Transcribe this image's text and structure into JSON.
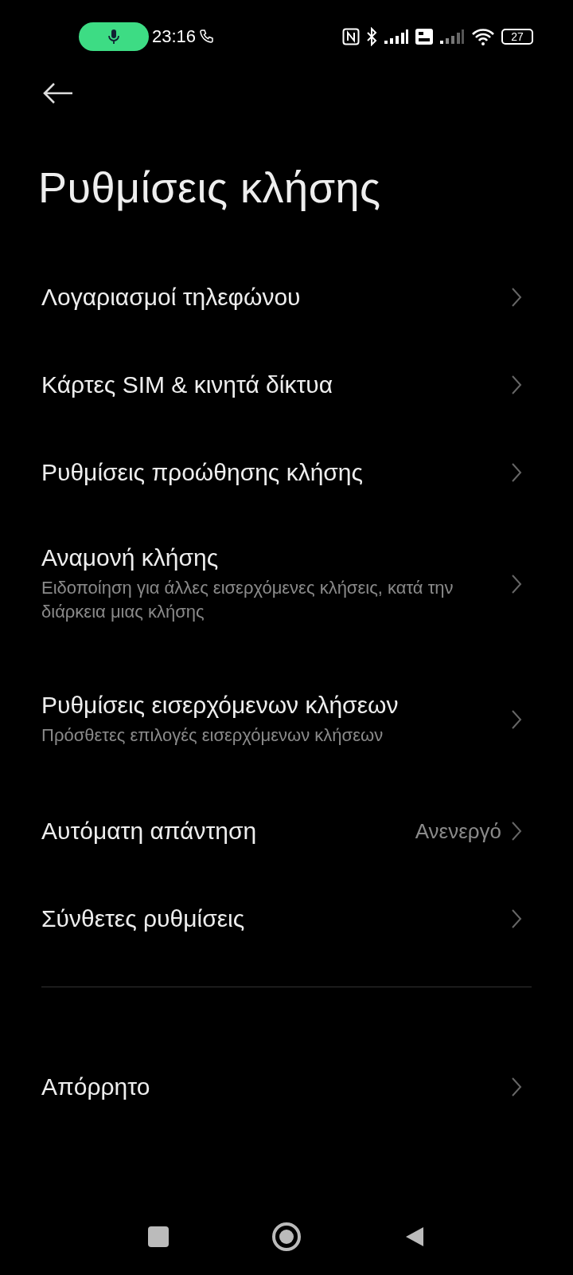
{
  "status_bar": {
    "time": "23:16",
    "battery": "27"
  },
  "title": "Ρυθμίσεις κλήσης",
  "groups": [
    {
      "items": [
        {
          "label": "Λογαριασμοί τηλεφώνου"
        },
        {
          "label": "Κάρτες SIM & κινητά δίκτυα"
        },
        {
          "label": "Ρυθμίσεις προώθησης κλήσης"
        },
        {
          "label": "Αναμονή κλήσης",
          "subtitle": "Ειδοποίηση για άλλες εισερχόμενες κλήσεις, κατά την διάρκεια μιας κλήσης"
        },
        {
          "label": "Ρυθμίσεις εισερχόμενων κλήσεων",
          "subtitle": "Πρόσθετες επιλογές εισερχόμενων κλήσεων"
        },
        {
          "label": "Αυτόματη απάντηση",
          "value": "Ανενεργό"
        },
        {
          "label": "Σύνθετες ρυθμίσεις"
        }
      ]
    },
    {
      "items": [
        {
          "label": "Απόρρητο"
        }
      ]
    }
  ]
}
